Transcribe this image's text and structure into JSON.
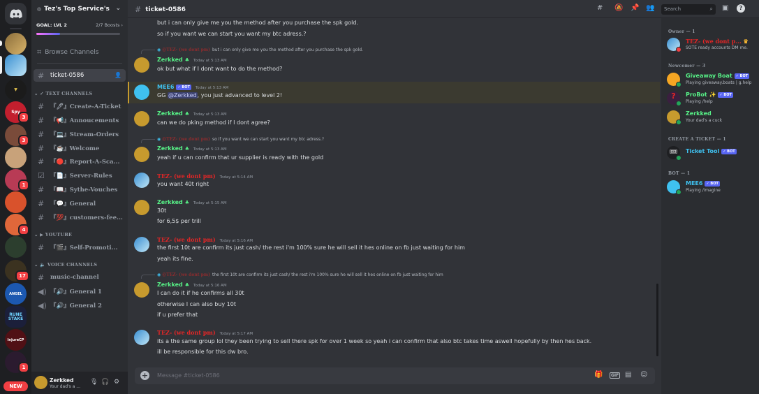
{
  "server": {
    "name": "Tez's Top Service's",
    "goal_label": "GOAL: LVL 2",
    "boosts": "2/7 Boosts",
    "goal_progress": 0.286
  },
  "browse_label": "Browse Channels",
  "current_channel": "ticket-0586",
  "categories": {
    "text": "TEXT CHANNELS",
    "youtube": "YOUTUBE",
    "voice": "VOICE CHANNELS"
  },
  "channel_list": [
    "『🖊』Create-A-Ticket",
    "『📢』Annoucements",
    "『💻』Stream-Orders",
    "『☕』Welcome",
    "『🔴』Report-A-Sca...",
    "『📄』Server-Rules",
    "『📖』Sythe-Vouches",
    "『💬』General",
    "『💯』customers-fee...",
    "『🎬』Self-Promoti...",
    "music-channel",
    "『🔊』General 1",
    "『🔊』General 2"
  ],
  "guild_badges": [
    "3",
    "3",
    "1",
    "4",
    "17",
    "1"
  ],
  "guild_labels": {
    "rune": "RUNE STAKE",
    "injure": "InjureCP",
    "new": "NEW"
  },
  "user": {
    "name": "Zerkked",
    "status": "Your dad's a ..."
  },
  "search_placeholder": "Search",
  "composer_placeholder": "Message #ticket-0586",
  "composer_icons": {
    "gif": "GIF"
  },
  "messages": {
    "top1": "but i can only give me you the method after you purchase the spk gold.",
    "top2": "so if you want we can start you want my btc adress.?",
    "m1_reply_name": "@TEZ- (we dont pm)",
    "m1_reply_text": "but i can only give me you the method after you purchase the spk gold.",
    "m1_user": "Zerkked",
    "m1_ts": "Today at 5:13 AM",
    "m1_text": "ok but what if I dont want to do the method?",
    "m2_user": "MEE6",
    "m2_bot": "✓ BOT",
    "m2_ts": "Today at 5:13 AM",
    "m2_pre": "GG ",
    "m2_mention": "@Zerkked",
    "m2_post": ", you just advanced to level 2!",
    "m3_user": "Zerkked",
    "m3_ts": "Today at 5:13 AM",
    "m3_text": "can we do pking method if I dont agree?",
    "m4_reply_name": "@TEZ- (we dont pm)",
    "m4_reply_text": "so if you want we can start you want my btc adress.?",
    "m4_user": "Zerkked",
    "m4_ts": "Today at 5:13 AM",
    "m4_text": "yeah if u can confirm that ur supplier is ready with the gold",
    "m5_user": "TEZ- (we dont pm)",
    "m5_ts": "Today at 5:14 AM",
    "m5_text": "you want 40t right",
    "m6_user": "Zerkked",
    "m6_ts": "Today at 5:15 AM",
    "m6_l1": "30t",
    "m6_l2": "for 6,5$ per trill",
    "m7_user": "TEZ- (we dont pm)",
    "m7_ts": "Today at 5:16 AM",
    "m7_l1": "the first 10t are confirm its just cash/ the rest i'm 100% sure he will sell it hes online on fb just waiting  for him",
    "m7_l2": "yeah its fine.",
    "m8_reply_name": "@TEZ- (we dont pm)",
    "m8_reply_text": "the first 10t are confirm its just cash/ the rest i'm 100% sure he will sell it hes online on fb just waiting for him",
    "m8_user": "Zerkked",
    "m8_ts": "Today at 5:16 AM",
    "m8_l1": "I can do it if he confirms all 30t",
    "m8_l2": "otherwise I can also buy 10t",
    "m8_l3": "if u prefer that",
    "m9_user": "TEZ- (we dont pm)",
    "m9_ts": "Today at 5:17 AM",
    "m9_l1": "its a the same group  lol they been trying to sell there spk for over 1 week so yeah i can confirm that also btc takes time aswell hopefully by then hes back.",
    "m9_l2": "ill be responsible for this dw bro."
  },
  "members": {
    "owner_header": "Owner — 1",
    "owner": {
      "name": "TEZ- (we dont p...",
      "status": "SOTE ready accounts DM me."
    },
    "newcomer_header": "Newcomer — 3",
    "newcomers": [
      {
        "name": "Giveaway Boat",
        "bot": "✓ BOT",
        "status": "Playing giveaway.boats | g.help"
      },
      {
        "name": "ProBot ✨",
        "bot": "✓ BOT",
        "status": "Playing /help"
      },
      {
        "name": "Zerkked",
        "status": "Your dad's a cuck"
      }
    ],
    "ticket_header": "CREATE A TICKET — 1",
    "ticket": {
      "name": "Ticket Tool",
      "bot": "✓ BOT"
    },
    "bot_header": "BOT — 1",
    "bot": {
      "name": "MEE6",
      "bot": "✓ BOT",
      "status": "Playing /imagine"
    }
  },
  "colors": {
    "accent": "#5865f2",
    "online": "#23a55a",
    "dnd": "#f23f43",
    "tez": "#e32626",
    "zerkked": "#57f287",
    "mee6": "#3fc1f0"
  },
  "icons": [
    "discord-logo-icon",
    "hashtag-icon",
    "threads-icon",
    "mute-icon",
    "pin-icon",
    "members-icon",
    "search-icon",
    "inbox-icon",
    "help-icon",
    "gift-icon",
    "sticker-icon",
    "emoji-icon",
    "mic-icon",
    "headphones-icon",
    "settings-icon"
  ]
}
